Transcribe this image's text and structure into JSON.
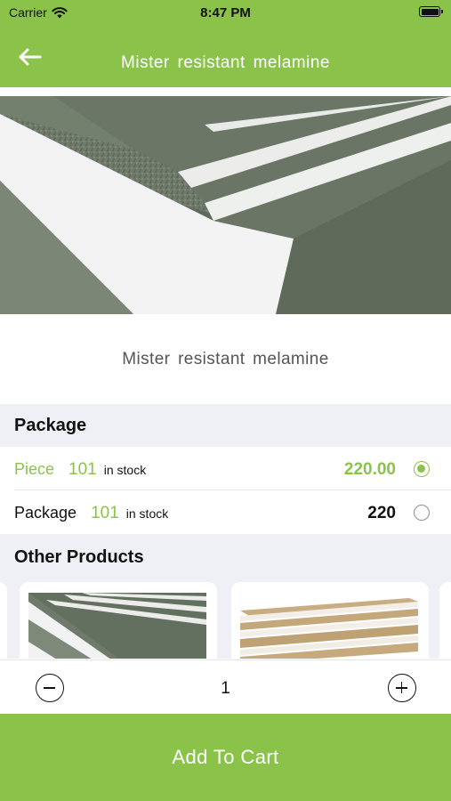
{
  "status_bar": {
    "carrier": "Carrier",
    "time": "8:47 PM"
  },
  "header": {
    "title": "Mister resistant melamine"
  },
  "product": {
    "name": "Mister resistant melamine"
  },
  "package_section": {
    "title": "Package",
    "options": [
      {
        "label": "Piece",
        "quantity": "101",
        "stock_label": "in stock",
        "price": "220.00",
        "selected": true
      },
      {
        "label": "Package",
        "quantity": "101",
        "stock_label": "in stock",
        "price": "220",
        "selected": false
      }
    ]
  },
  "other_products": {
    "title": "Other Products"
  },
  "stepper": {
    "value": "1"
  },
  "cart": {
    "button_label": "Add To Cart"
  },
  "colors": {
    "brand": "#8bc34a",
    "section_bg": "#eff0f5",
    "text": "#111111"
  }
}
